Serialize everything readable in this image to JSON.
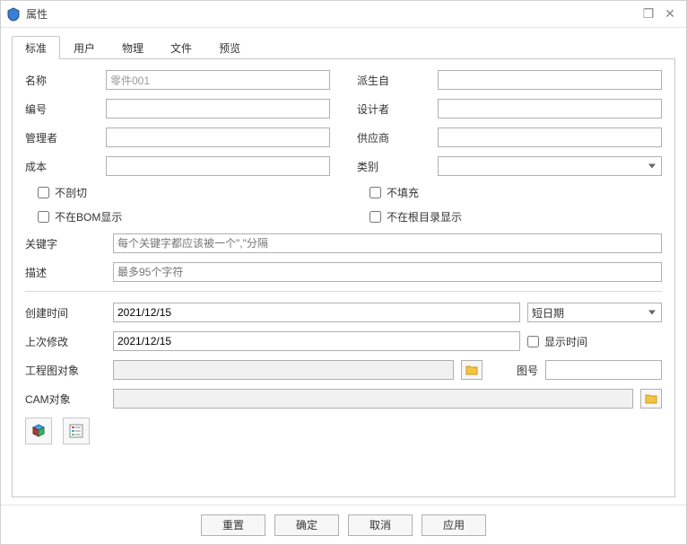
{
  "window": {
    "title": "属性"
  },
  "tabs": {
    "standard": "标准",
    "user": "用户",
    "physics": "物理",
    "file": "文件",
    "preview": "预览"
  },
  "labels": {
    "name": "名称",
    "derived_from": "派生自",
    "number": "编号",
    "designer": "设计者",
    "manager": "管理者",
    "supplier": "供应商",
    "cost": "成本",
    "category": "类别",
    "no_section": "不剖切",
    "no_fill": "不填充",
    "not_in_bom": "不在BOM显示",
    "not_in_root": "不在根目录显示",
    "keywords": "关键字",
    "description": "描述",
    "created": "创建时间",
    "modified": "上次修改",
    "show_time": "显示时间",
    "drawing_obj": "工程图对象",
    "drawing_no": "图号",
    "cam_obj": "CAM对象"
  },
  "values": {
    "name": "零件001",
    "derived_from": "",
    "number": "",
    "designer": "",
    "manager": "",
    "supplier": "",
    "cost": "",
    "category": "",
    "keywords": "",
    "description": "",
    "created": "2021/12/15",
    "modified": "2021/12/15",
    "date_format": "短日期",
    "drawing_obj": "",
    "drawing_no": "",
    "cam_obj": ""
  },
  "placeholders": {
    "keywords": "每个关键字都应该被一个\",\"分隔",
    "description": "最多95个字符"
  },
  "checkboxes": {
    "no_section": false,
    "no_fill": false,
    "not_in_bom": false,
    "not_in_root": false,
    "show_time": false
  },
  "buttons": {
    "reset": "重置",
    "ok": "确定",
    "cancel": "取消",
    "apply": "应用"
  }
}
